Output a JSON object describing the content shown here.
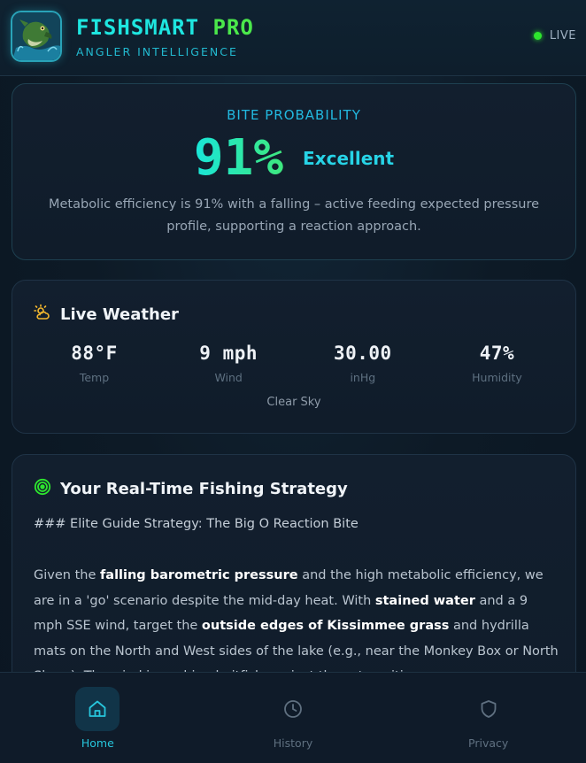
{
  "header": {
    "title_main": "FISHSMART",
    "title_accent": "PRO",
    "subtitle": "ANGLER INTELLIGENCE",
    "status": "LIVE"
  },
  "bite": {
    "label": "BITE PROBABILITY",
    "value": "91%",
    "rating": "Excellent",
    "description": "Metabolic efficiency is 91% with a falling – active feeding expected pressure profile, supporting a reaction approach."
  },
  "weather": {
    "title": "Live Weather",
    "metrics": [
      {
        "value": "88°F",
        "label": "Temp"
      },
      {
        "value": "9 mph",
        "label": "Wind"
      },
      {
        "value": "30.00",
        "label": "inHg"
      },
      {
        "value": "47%",
        "label": "Humidity"
      }
    ],
    "condition": "Clear Sky"
  },
  "strategy": {
    "title": "Your Real-Time Fishing Strategy",
    "heading": "### Elite Guide Strategy: The Big O Reaction Bite",
    "p1": "Given the ",
    "b1": "falling barometric pressure",
    "p2": " and the high metabolic efficiency, we are in a 'go' scenario despite the mid-day heat. With ",
    "b2": "stained water",
    "p3": " and a 9 mph SSE wind, target the ",
    "b3": "outside edges of Kissimmee grass",
    "p4": " and hydrilla mats on the North and West sides of the lake (e.g., near the Monkey Box or North Shore). The wind is pushing baitfish against these transitions"
  },
  "tabs": [
    {
      "label": "Home",
      "icon": "home-icon"
    },
    {
      "label": "History",
      "icon": "clock-icon"
    },
    {
      "label": "Privacy",
      "icon": "shield-icon"
    }
  ],
  "colors": {
    "accent_cyan": "#1ee6e0",
    "accent_green": "#4be84b",
    "live_green": "#2ee62e",
    "weather_icon": "#f5b82e",
    "background": "#0d1a26"
  }
}
